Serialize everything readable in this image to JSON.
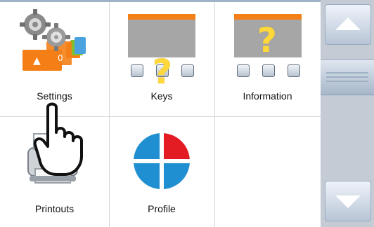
{
  "tiles": [
    {
      "label": "Settings",
      "icon": "settings-icon"
    },
    {
      "label": "Keys",
      "icon": "keys-icon"
    },
    {
      "label": "Information",
      "icon": "information-icon"
    },
    {
      "label": "Printouts",
      "icon": "printer-icon"
    },
    {
      "label": "Profile",
      "icon": "profile-icon"
    }
  ],
  "scroll": {
    "up_icon": "chevron-up-icon",
    "down_icon": "chevron-down-icon"
  },
  "colors": {
    "orange": "#f47f16",
    "yellow": "#ffd83b",
    "profile_red": "#e31b23",
    "profile_blue": "#1f8fd1",
    "gray_panel": "#a6a6a6"
  },
  "cursor_icon": "hand-pointer-icon"
}
